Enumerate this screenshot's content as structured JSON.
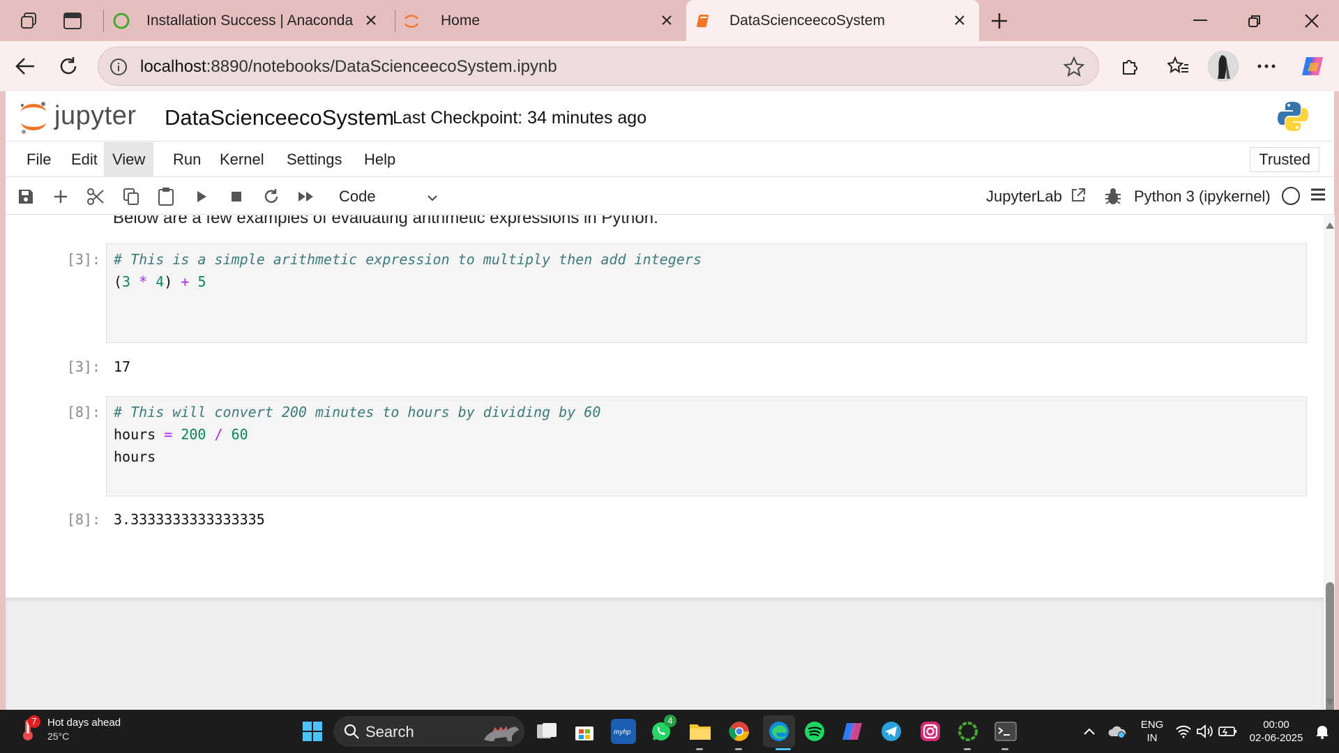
{
  "browser": {
    "tabs": [
      {
        "title": "Installation Success | Anaconda",
        "active": false
      },
      {
        "title": "Home",
        "active": false
      },
      {
        "title": "DataScienceecoSystem",
        "active": true
      }
    ],
    "url_host": "localhost",
    "url_rest": ":8890/notebooks/DataScienceecoSystem.ipynb"
  },
  "jupyter": {
    "logo_text": "jupyter",
    "notebook_title": "DataScienceecoSystem",
    "checkpoint": "Last Checkpoint: 34 minutes ago",
    "menu": [
      "File",
      "Edit",
      "View",
      "Run",
      "Kernel",
      "Settings",
      "Help"
    ],
    "trusted": "Trusted",
    "cell_type": "Code",
    "jupyterlab_link": "JupyterLab",
    "kernel": "Python 3 (ipykernel)"
  },
  "notebook": {
    "markdown_partial": "Below are a few examples of evaluating arithmetic expressions in Python.",
    "cells": [
      {
        "prompt_in": "[3]:",
        "lines": [
          "# This is a simple arithmetic expression to multiply then add integers",
          "(3 * 4) + 5"
        ],
        "prompt_out": "[3]:",
        "output": "17"
      },
      {
        "prompt_in": "[8]:",
        "lines": [
          "# This will convert 200 minutes to hours by dividing by 60",
          "hours = 200 / 60",
          "hours"
        ],
        "prompt_out": "[8]:",
        "output": "3.3333333333333335"
      }
    ],
    "active_prompt": "[ ]:"
  },
  "taskbar": {
    "weather_title": "Hot days ahead",
    "weather_temp": "25°C",
    "weather_badge": "7",
    "search": "Search",
    "whatsapp_badge": "4",
    "lang_line1": "ENG",
    "lang_line2": "IN",
    "time": "00:00",
    "date": "02-06-2025"
  },
  "colors": {
    "accent": "#1976d2",
    "tabstrip": "#e7bebe",
    "taskbar": "#1c1c1c"
  }
}
